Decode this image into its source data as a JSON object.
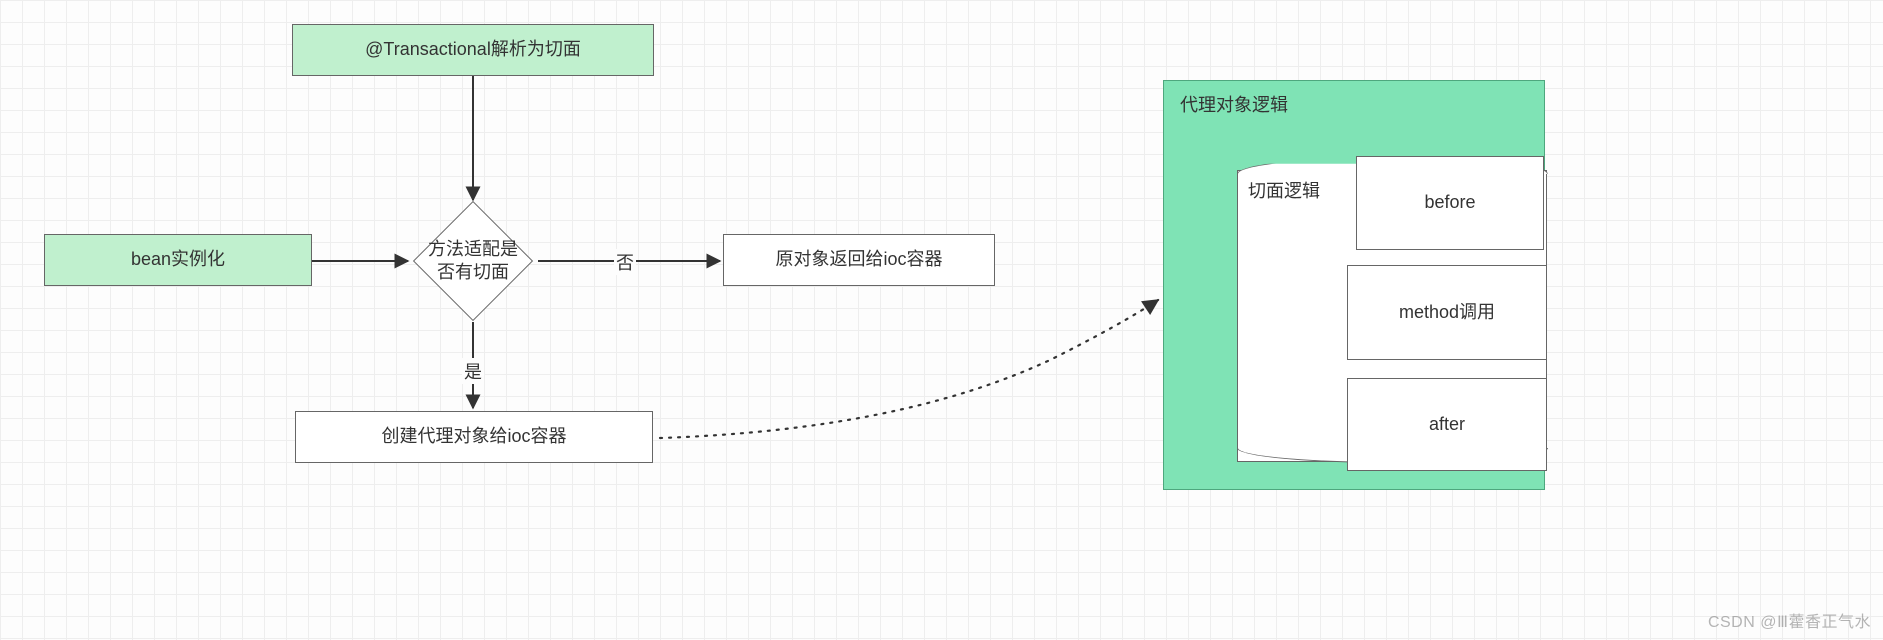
{
  "nodes": {
    "transactional": "@Transactional解析为切面",
    "bean_instance": "bean实例化",
    "method_match": "方法适配是否有切面",
    "original_return": "原对象返回给ioc容器",
    "create_proxy": "创建代理对象给ioc容器",
    "proxy_logic_title": "代理对象逻辑",
    "aspect_logic_title": "切面逻辑",
    "before": "before",
    "method_call": "method调用",
    "after": "after"
  },
  "edges": {
    "no": "否",
    "yes": "是"
  },
  "colors": {
    "green_fill": "#c0f0ce",
    "mint_fill": "#7fe3b5",
    "border": "#666666"
  },
  "watermark": "CSDN @Ⅲ藿香正气水"
}
